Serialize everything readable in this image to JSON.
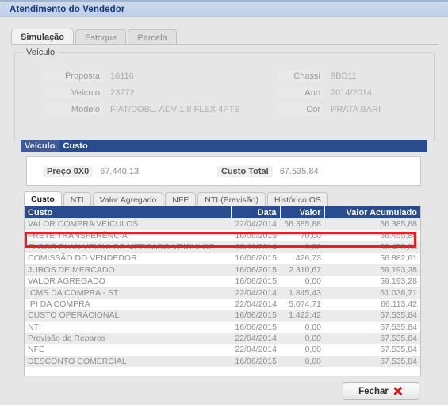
{
  "window": {
    "title": "Atendimento do Vendedor"
  },
  "outer_tabs": [
    {
      "label": "Simulação",
      "active": true
    },
    {
      "label": "Estoque",
      "active": false
    },
    {
      "label": "Parcela",
      "active": false
    }
  ],
  "veiculo": {
    "legend": "Veículo",
    "fields_left": [
      {
        "label": "Proposta",
        "value": "16116"
      },
      {
        "label": "Veículo",
        "value": "23272"
      },
      {
        "label": "Modelo",
        "value": "FIAT/DOBL. ADV 1.8 FLEX 4PTS"
      }
    ],
    "fields_right": [
      {
        "label": "Chassi",
        "value": "9BD11"
      },
      {
        "label": "Ano",
        "value": "2014/2014"
      },
      {
        "label": "Cor",
        "value": "PRATA BARI"
      }
    ]
  },
  "section_bar": [
    {
      "label": "Veículo",
      "active": false
    },
    {
      "label": "Custo",
      "active": true
    }
  ],
  "preco_panel": {
    "preco_label": "Preço 0X0",
    "preco_value": "67.440,13",
    "custo_total_label": "Custo Total",
    "custo_total_value": "67.535,84"
  },
  "inner_tabs": [
    {
      "label": "Custo",
      "active": true
    },
    {
      "label": "NTI",
      "active": false
    },
    {
      "label": "Valor Agregado",
      "active": false
    },
    {
      "label": "NFE",
      "active": false
    },
    {
      "label": "NTI (Previsão)",
      "active": false
    },
    {
      "label": "Histórico OS",
      "active": false
    }
  ],
  "table": {
    "columns": [
      "Custo",
      "Data",
      "Valor",
      "Valor Acumulado"
    ],
    "rows": [
      {
        "custo": "VALOR COMPRA VEICULOS",
        "data": "22/04/2014",
        "valor": "56.385,88",
        "acumulado": "56.385,88"
      },
      {
        "custo": "FRETE TRANSFERÊNCIA",
        "data": "16/06/2015",
        "valor": "70,00",
        "acumulado": "56.455,88"
      },
      {
        "custo": "FLOOR PLAN VEICULOS MERCADO VEICULOS",
        "data": "08/11/2014",
        "valor": "0,00",
        "acumulado": "56.455,88"
      },
      {
        "custo": "COMISSÃO DO VENDEDOR",
        "data": "16/06/2015",
        "valor": "426,73",
        "acumulado": "56.882,61"
      },
      {
        "custo": "JUROS DE MERCADO",
        "data": "16/06/2015",
        "valor": "2.310,67",
        "acumulado": "59.193,28"
      },
      {
        "custo": "VALOR AGREGADO",
        "data": "16/06/2015",
        "valor": "0,00",
        "acumulado": "59.193,28"
      },
      {
        "custo": "ICMS DA COMPRA - ST",
        "data": "22/04/2014",
        "valor": "1.845,43",
        "acumulado": "61.038,71"
      },
      {
        "custo": "IPI DA COMPRA",
        "data": "22/04/2014",
        "valor": "5.074,71",
        "acumulado": "66.113,42"
      },
      {
        "custo": "CUSTO OPERACIONAL",
        "data": "16/06/2015",
        "valor": "1.422,42",
        "acumulado": "67.535,84"
      },
      {
        "custo": "NTI",
        "data": "16/06/2015",
        "valor": "0,00",
        "acumulado": "67.535,84"
      },
      {
        "custo": "Previsão de Reparos",
        "data": "22/04/2014",
        "valor": "0,00",
        "acumulado": "67.535,84"
      },
      {
        "custo": "NFE",
        "data": "22/04/2014",
        "valor": "0,00",
        "acumulado": "67.535,84"
      },
      {
        "custo": "DESCONTO COMERCIAL",
        "data": "16/06/2015",
        "valor": "0,00",
        "acumulado": "67.535,84"
      }
    ],
    "highlighted_row_index": 1
  },
  "footer": {
    "close_label": "Fechar",
    "close_icon": "red-x-icon"
  },
  "colors": {
    "titlebar_bg": "#c6d4e8",
    "titlebar_text": "#14387f",
    "section_bar_bg": "#2a4b8d",
    "table_header_bg": "#2a4b8d",
    "row_stripe": "#ebebeb",
    "highlight_border": "#ee1c22",
    "close_icon": "#cc1f1f"
  }
}
